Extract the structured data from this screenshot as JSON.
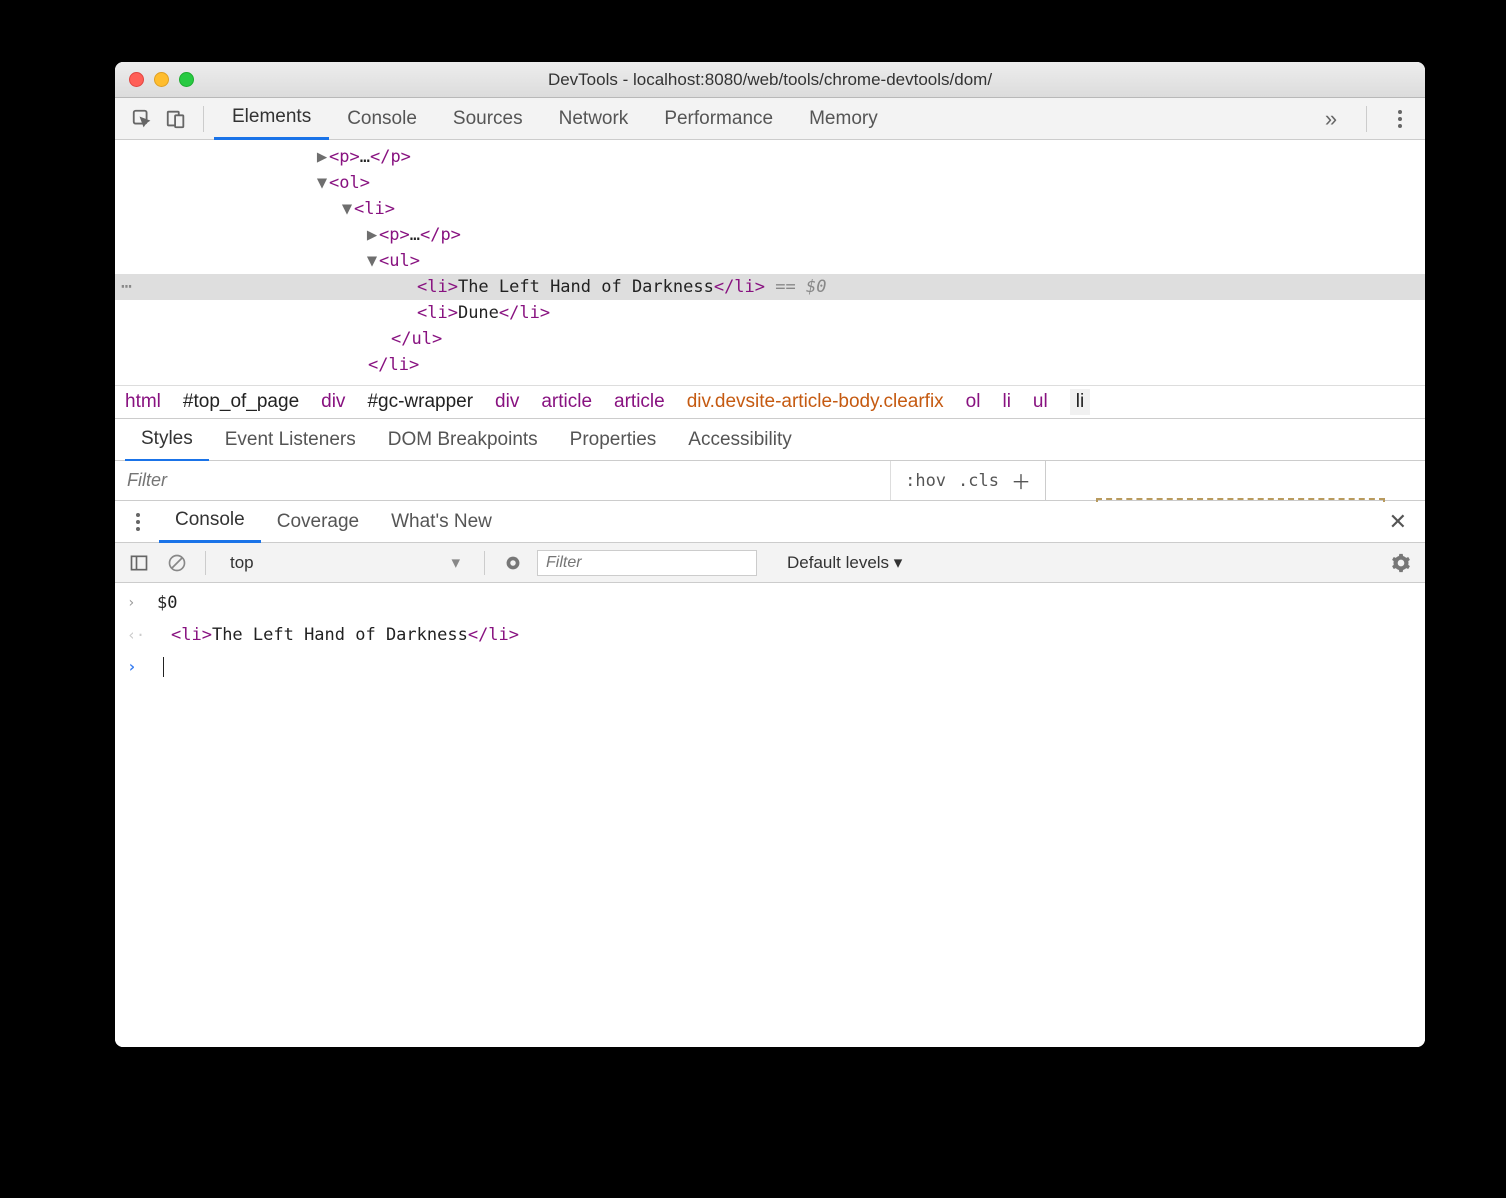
{
  "window": {
    "title": "DevTools - localhost:8080/web/tools/chrome-devtools/dom/"
  },
  "main_tabs": [
    "Elements",
    "Console",
    "Sources",
    "Network",
    "Performance",
    "Memory"
  ],
  "main_tab_active": "Elements",
  "dom_tree": {
    "lines": [
      {
        "indent": 170,
        "arrow": "▶",
        "open": "<p>",
        "mid": "…",
        "close": "</p>"
      },
      {
        "indent": 170,
        "arrow": "▼",
        "open": "<ol>"
      },
      {
        "indent": 195,
        "arrow": "▼",
        "open": "<li>"
      },
      {
        "indent": 220,
        "arrow": "▶",
        "open": "<p>",
        "mid": "…",
        "close": "</p>"
      },
      {
        "indent": 220,
        "arrow": "▼",
        "open": "<ul>"
      },
      {
        "indent": 258,
        "open": "<li>",
        "mid": "The Left Hand of Darkness",
        "close": "</li>",
        "suffix": " == $0",
        "selected": true
      },
      {
        "indent": 258,
        "open": "<li>",
        "mid": "Dune",
        "close": "</li>"
      },
      {
        "indent": 232,
        "open": "</ul>"
      },
      {
        "indent": 209,
        "open": "</li>"
      }
    ]
  },
  "breadcrumb": [
    {
      "text": "html",
      "cls": "bc-item"
    },
    {
      "text": "#top_of_page",
      "cls": "bc-item dark"
    },
    {
      "text": "div",
      "cls": "bc-item"
    },
    {
      "text": "#gc-wrapper",
      "cls": "bc-item dark"
    },
    {
      "text": "div",
      "cls": "bc-item"
    },
    {
      "text": "article",
      "cls": "bc-item"
    },
    {
      "text": "article",
      "cls": "bc-item"
    },
    {
      "text": "div.devsite-article-body.clearfix",
      "cls": "bc-item orange"
    },
    {
      "text": "ol",
      "cls": "bc-item"
    },
    {
      "text": "li",
      "cls": "bc-item"
    },
    {
      "text": "ul",
      "cls": "bc-item"
    },
    {
      "text": "li",
      "cls": "bc-item sel"
    }
  ],
  "subtabs": [
    "Styles",
    "Event Listeners",
    "DOM Breakpoints",
    "Properties",
    "Accessibility"
  ],
  "subtab_active": "Styles",
  "filter": {
    "placeholder": "Filter",
    "hov": ":hov",
    "cls": ".cls",
    "plus": "＋"
  },
  "drawer_tabs": [
    "Console",
    "Coverage",
    "What's New"
  ],
  "drawer_tab_active": "Console",
  "console_toolbar": {
    "context": "top",
    "filter_placeholder": "Filter",
    "levels": "Default levels ▾"
  },
  "console_lines": [
    {
      "glyph": "›",
      "glyphcls": "cglyph",
      "text": "$0",
      "plain": true
    },
    {
      "glyph": "‹·",
      "glyphcls": "cglyph lgray",
      "html": true,
      "open": "<li>",
      "mid": "The Left Hand of Darkness",
      "close": "</li>"
    },
    {
      "glyph": "›",
      "glyphcls": "cglyph blue",
      "prompt": true
    }
  ]
}
